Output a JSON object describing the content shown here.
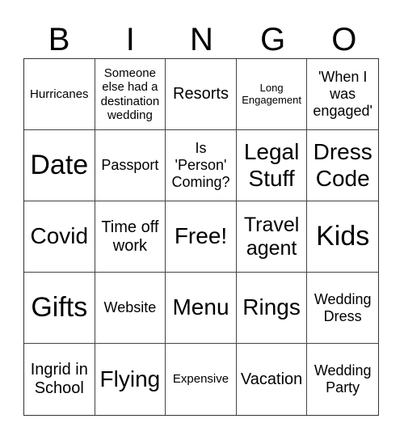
{
  "header": [
    "B",
    "I",
    "N",
    "G",
    "O"
  ],
  "cells": [
    {
      "text": "Hurricanes",
      "size": "s14"
    },
    {
      "text": "Someone else had a destination wedding",
      "size": "s14"
    },
    {
      "text": "Resorts",
      "size": "s20"
    },
    {
      "text": "Long Engagement",
      "size": "s12"
    },
    {
      "text": "'When I was engaged'",
      "size": "s17"
    },
    {
      "text": "Date",
      "size": "s34"
    },
    {
      "text": "Passport",
      "size": "s17"
    },
    {
      "text": "Is 'Person' Coming?",
      "size": "s17"
    },
    {
      "text": "Legal Stuff",
      "size": "s28"
    },
    {
      "text": "Dress Code",
      "size": "s28"
    },
    {
      "text": "Covid",
      "size": "s28"
    },
    {
      "text": "Time off work",
      "size": "s20"
    },
    {
      "text": "Free!",
      "size": "s28"
    },
    {
      "text": "Travel agent",
      "size": "s24"
    },
    {
      "text": "Kids",
      "size": "s34"
    },
    {
      "text": "Gifts",
      "size": "s34"
    },
    {
      "text": "Website",
      "size": "s17"
    },
    {
      "text": "Menu",
      "size": "s28"
    },
    {
      "text": "Rings",
      "size": "s28"
    },
    {
      "text": "Wedding Dress",
      "size": "s17"
    },
    {
      "text": "Ingrid in School",
      "size": "s20"
    },
    {
      "text": "Flying",
      "size": "s28"
    },
    {
      "text": "Expensive",
      "size": "s14"
    },
    {
      "text": "Vacation",
      "size": "s20"
    },
    {
      "text": "Wedding Party",
      "size": "s17"
    }
  ]
}
